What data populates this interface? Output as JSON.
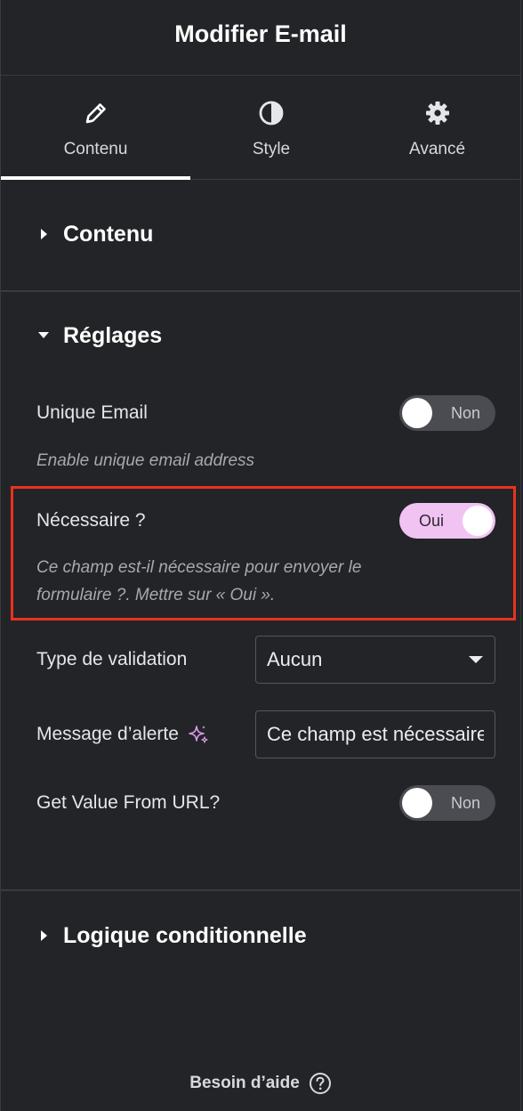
{
  "header": {
    "title": "Modifier E-mail"
  },
  "tabs": [
    {
      "label": "Contenu",
      "icon": "pencil-icon",
      "active": true
    },
    {
      "label": "Style",
      "icon": "contrast-icon",
      "active": false
    },
    {
      "label": "Avancé",
      "icon": "gear-icon",
      "active": false
    }
  ],
  "sections": {
    "contenu": {
      "title": "Contenu",
      "expanded": false
    },
    "reglages": {
      "title": "Réglages",
      "expanded": true,
      "unique_email": {
        "label": "Unique Email",
        "toggle": "Non",
        "description": "Enable unique email address"
      },
      "necessaire": {
        "label": "Nécessaire ?",
        "toggle": "Oui",
        "description_line1": "Ce champ est-il nécessaire pour envoyer le",
        "description_line2": "formulaire ?. Mettre sur « Oui »."
      },
      "type_validation": {
        "label": "Type de validation",
        "value": "Aucun"
      },
      "message_alerte": {
        "label": "Message d’alerte",
        "value": "Ce champ est nécessaire"
      },
      "get_value_url": {
        "label": "Get Value From URL?",
        "toggle": "Non"
      }
    },
    "logique": {
      "title": "Logique conditionnelle",
      "expanded": false
    }
  },
  "footer": {
    "label": "Besoin d’aide"
  },
  "colors": {
    "background": "#232427",
    "toggle_on": "#f1c3f3",
    "toggle_off": "#4a4c52",
    "highlight": "#e8321f",
    "ai_icon": "#d99de6"
  }
}
